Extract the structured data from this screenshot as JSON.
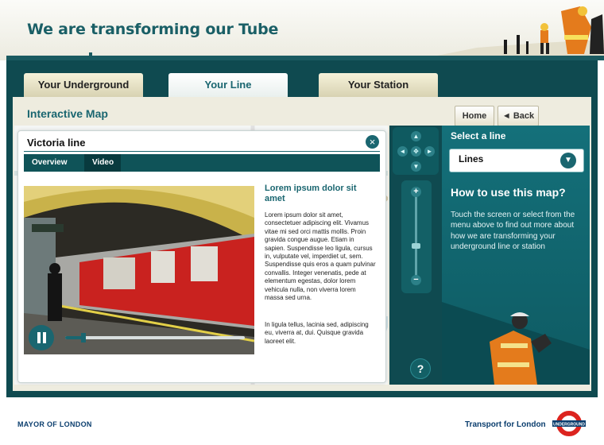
{
  "header": {
    "title": "We are transforming our Tube"
  },
  "tabs": [
    {
      "label": "Your Underground",
      "active": false
    },
    {
      "label": "Your Line",
      "active": true
    },
    {
      "label": "Your Station",
      "active": false
    }
  ],
  "map": {
    "title": "Interactive Map",
    "home_label": "Home",
    "back_label": "◄ Back"
  },
  "panel": {
    "title": "Victoria line",
    "close_icon": "close-icon",
    "subtabs": [
      {
        "label": "Overview",
        "active": false
      },
      {
        "label": "Video",
        "active": true
      }
    ],
    "article": {
      "heading": "Lorem ipsum dolor sit amet",
      "paragraphs": [
        "Lorem ipsum dolor sit amet, consectetuer adipiscing elit. Vivamus vitae mi sed orci mattis mollis. Proin gravida congue augue. Etiam in sapien. Suspendisse leo ligula, cursus in, vulputate vel, imperdiet ut, sem. Suspendisse quis eros a quam pulvinar convallis. Integer venenatis, pede at elementum egestas, dolor lorem vehicula nulla, non viverra lorem massa sed urna.",
        "In ligula tellus, lacinia sed, adipiscing eu, viverra at, dui. Quisque gravida laoreet elit."
      ]
    },
    "video": {
      "progress": 0.1,
      "state": "playing"
    }
  },
  "map_controls": {
    "pan_icons": [
      "arrow-up-icon",
      "arrow-left-icon",
      "center-icon",
      "arrow-right-icon",
      "arrow-down-icon"
    ],
    "zoom_in": "+",
    "zoom_out": "−",
    "help": "?"
  },
  "right_panel": {
    "select_heading": "Select a line",
    "select_value": "Lines",
    "howto_heading": "How to use this map?",
    "howto_text": "Touch the screen or select from the menu above to find out more about how we are transforming your underground line or station"
  },
  "footer": {
    "left": "MAYOR OF LONDON",
    "right": "Transport for London",
    "roundel_text": "UNDERGROUND"
  },
  "colors": {
    "brand_teal": "#1a6670",
    "frame_dark": "#0f4a50",
    "tfl_blue": "#0b3e6e",
    "roundel_red": "#dc241f"
  }
}
